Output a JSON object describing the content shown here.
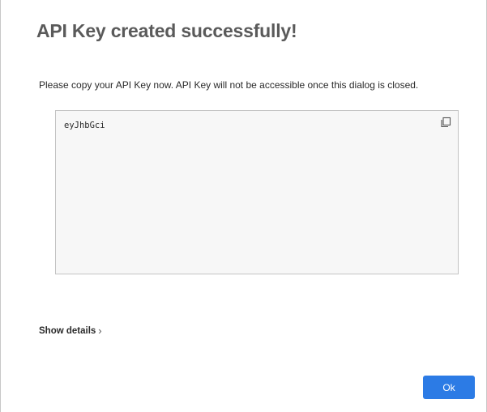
{
  "dialog": {
    "title": "API Key created successfully!",
    "message": "Please copy your API Key now. API Key will not be accessible once this dialog is closed.",
    "api_key": "eyJhbGci",
    "copy_icon": "copy-icon",
    "show_details_label": "Show details",
    "show_details_icon": "chevron-right-icon",
    "ok_label": "Ok"
  },
  "colors": {
    "primary_button": "#2c7be5",
    "title_text": "#5a5a5a",
    "key_box_background": "#f7f7f7"
  }
}
